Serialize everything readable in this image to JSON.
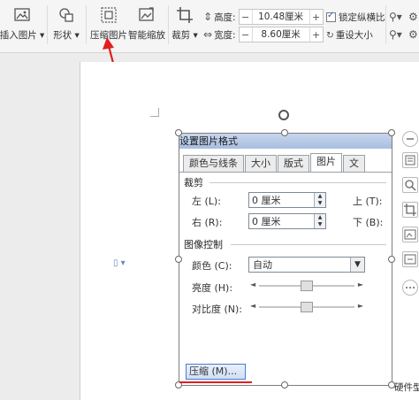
{
  "ribbon": {
    "insert_picture": "插入图片",
    "shape": "形状",
    "compress_picture": "压缩图片",
    "smart_zoom": "智能缩放",
    "crop": "裁剪",
    "height_label": "高度:",
    "height_value": "10.48厘米",
    "width_label": "宽度:",
    "width_value": "8.60厘米",
    "lock_ratio": "锁定纵横比",
    "reset_size": "重设大小",
    "minus": "−",
    "plus": "+"
  },
  "dialog": {
    "title": "设置图片格式",
    "tabs": [
      "颜色与线条",
      "大小",
      "版式",
      "图片",
      "文"
    ],
    "active_tab": "图片",
    "crop_section": "裁剪",
    "left_label": "左 (L):",
    "left_value": "0 厘米",
    "right_label": "右 (R):",
    "right_value": "0 厘米",
    "top_label": "上 (T):",
    "bottom_label": "下 (B):",
    "image_control": "图像控制",
    "color_label": "颜色 (C):",
    "color_value": "自动",
    "brightness_label": "亮度 (H):",
    "contrast_label": "对比度 (N):",
    "compress_button": "压缩 (M)...",
    "brightness_level": 0.5,
    "contrast_level": 0.5
  },
  "page": {
    "cut_text": "硬件型"
  },
  "colors": {
    "annotation_red": "#e02020",
    "dialog_title_bg": "#a8bde0"
  }
}
